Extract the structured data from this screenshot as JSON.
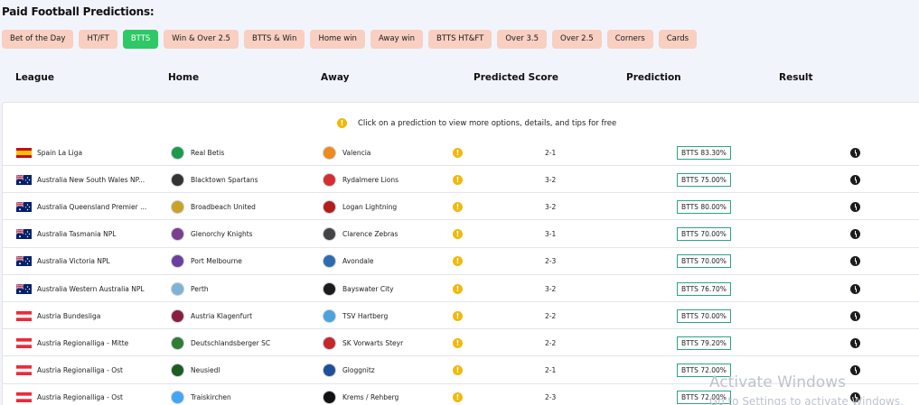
{
  "page_title": "Paid Football Predictions:",
  "tabs": [
    {
      "label": "Bet of the Day",
      "active": false
    },
    {
      "label": "HT/FT",
      "active": false
    },
    {
      "label": "BTTS",
      "active": true
    },
    {
      "label": "Win & Over 2.5",
      "active": false
    },
    {
      "label": "BTTS & Win",
      "active": false
    },
    {
      "label": "Home win",
      "active": false
    },
    {
      "label": "Away win",
      "active": false
    },
    {
      "label": "BTTS HT&FT",
      "active": false
    },
    {
      "label": "Over 3.5",
      "active": false
    },
    {
      "label": "Over 2.5",
      "active": false
    },
    {
      "label": "Corners",
      "active": false
    },
    {
      "label": "Cards",
      "active": false
    }
  ],
  "columns": {
    "league": "League",
    "home": "Home",
    "away": "Away",
    "score": "Predicted Score",
    "prediction": "Prediction",
    "result": "Result"
  },
  "notice": "Click on a prediction to view more options, details, and tips for free",
  "colors": {
    "tab_bg": "#f8cfc1",
    "tab_active": "#2ec866",
    "info_icon": "#f0b90b",
    "prediction_border": "#2aa38a"
  },
  "rows": [
    {
      "league": "Spain La Liga",
      "flag": "spain-flag",
      "home": "Real Betis",
      "away": "Valencia",
      "score": "2-1",
      "prediction": "BTTS 83.30%",
      "home_color": "#1b9a4a",
      "away_color": "#f08a1c"
    },
    {
      "league": "Australia New South Wales NP...",
      "flag": "australia-flag",
      "home": "Blacktown Spartans",
      "away": "Rydalmere Lions",
      "score": "3-2",
      "prediction": "BTTS 75.00%",
      "home_color": "#333333",
      "away_color": "#d32f2f"
    },
    {
      "league": "Australia Queensland Premier ...",
      "flag": "australia-flag",
      "home": "Broadbeach United",
      "away": "Logan Lightning",
      "score": "3-2",
      "prediction": "BTTS 80.00%",
      "home_color": "#c9a227",
      "away_color": "#b71c1c"
    },
    {
      "league": "Australia Tasmania NPL",
      "flag": "australia-flag",
      "home": "Glenorchy Knights",
      "away": "Clarence Zebras",
      "score": "3-1",
      "prediction": "BTTS 70.00%",
      "home_color": "#7b3f8f",
      "away_color": "#444444"
    },
    {
      "league": "Australia Victoria NPL",
      "flag": "australia-flag",
      "home": "Port Melbourne",
      "away": "Avondale",
      "score": "2-3",
      "prediction": "BTTS 70.00%",
      "home_color": "#6a3fa0",
      "away_color": "#2b6cb0"
    },
    {
      "league": "Australia Western Australia NPL",
      "flag": "australia-flag",
      "home": "Perth",
      "away": "Bayswater City",
      "score": "3-2",
      "prediction": "BTTS 76.70%",
      "home_color": "#7fb3d5",
      "away_color": "#1c1c1c"
    },
    {
      "league": "Austria Bundesliga",
      "flag": "austria-flag",
      "home": "Austria Klagenfurt",
      "away": "TSV Hartberg",
      "score": "2-2",
      "prediction": "BTTS 70.00%",
      "home_color": "#8b1e3f",
      "away_color": "#4aa3df"
    },
    {
      "league": "Austria Regionalliga - Mitte",
      "flag": "austria-flag",
      "home": "Deutschlandsberger SC",
      "away": "SK Vorwarts Steyr",
      "score": "2-2",
      "prediction": "BTTS 79.20%",
      "home_color": "#2e7d32",
      "away_color": "#c62828"
    },
    {
      "league": "Austria Regionalliga - Ost",
      "flag": "austria-flag",
      "home": "Neusiedl",
      "away": "Gloggnitz",
      "score": "2-1",
      "prediction": "BTTS 72.00%",
      "home_color": "#1b5e20",
      "away_color": "#1e4f9c"
    },
    {
      "league": "Austria Regionalliga - Ost",
      "flag": "austria-flag",
      "home": "Traiskirchen",
      "away": "Krems / Rehberg",
      "score": "2-3",
      "prediction": "BTTS 72.00%",
      "home_color": "#42a5f5",
      "away_color": "#111111"
    }
  ],
  "watermark": {
    "title": "Activate Windows",
    "subtitle": "Go to Settings to activate Windows."
  }
}
